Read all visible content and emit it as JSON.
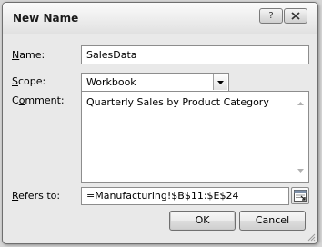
{
  "dialog": {
    "title": "New Name",
    "help_label": "?",
    "name": {
      "label_prefix": "",
      "label_accel": "N",
      "label_rest": "ame:",
      "value": "SalesData"
    },
    "scope": {
      "label_prefix": "",
      "label_accel": "S",
      "label_rest": "cope:",
      "value": "Workbook"
    },
    "comment": {
      "label_prefix": "C",
      "label_accel": "o",
      "label_rest": "mment:",
      "value": "Quarterly Sales by Product Category"
    },
    "refers_to": {
      "label_prefix": "",
      "label_accel": "R",
      "label_rest": "efers to:",
      "value": "=Manufacturing!$B$11:$E$24"
    },
    "ok_label": "OK",
    "cancel_label": "Cancel"
  },
  "icons": {
    "close": "close-icon",
    "dropdown": "chevron-down-icon",
    "collapse": "collapse-dialog-icon",
    "scroll_up": "scroll-up-icon",
    "scroll_down": "scroll-down-icon",
    "grip": "resize-grip-icon"
  },
  "colors": {
    "dialog_bg": "#e9e9e9",
    "border": "#6f6f6f",
    "field_border": "#8d8d8d"
  }
}
